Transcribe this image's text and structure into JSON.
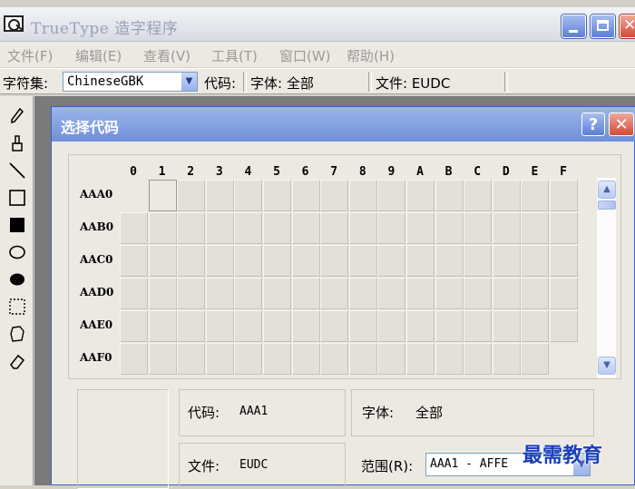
{
  "window": {
    "title": "TrueType 造字程序",
    "icon": "magnifier-icon"
  },
  "menu": [
    {
      "label": "文件(F)"
    },
    {
      "label": "编辑(E)"
    },
    {
      "label": "查看(V)"
    },
    {
      "label": "工具(T)"
    },
    {
      "label": "窗口(W)"
    },
    {
      "label": "帮助(H)"
    }
  ],
  "toolbar": {
    "charset_label": "字符集:",
    "charset_value": "ChineseGBK",
    "code_label": "代码:",
    "font_text": "字体: 全部",
    "file_text": "文件: EUDC"
  },
  "tools": [
    "pencil-icon",
    "brush-icon",
    "line-icon",
    "hollow-rectangle-icon",
    "filled-rectangle-icon",
    "hollow-ellipse-icon",
    "filled-ellipse-icon",
    "rectangle-select-icon",
    "freeform-select-icon",
    "eraser-icon"
  ],
  "dialog": {
    "title": "选择代码",
    "help_label": "?",
    "close_label": "✕",
    "column_headers": [
      "0",
      "1",
      "2",
      "3",
      "4",
      "5",
      "6",
      "7",
      "8",
      "9",
      "A",
      "B",
      "C",
      "D",
      "E",
      "F"
    ],
    "row_headers": [
      "AAA0",
      "AAB0",
      "AAC0",
      "AAD0",
      "AAE0",
      "AAF0"
    ],
    "code_label": "代码:",
    "code_value": "AAA1",
    "font_label": "字体:",
    "font_value": "全部",
    "file_label": "文件:",
    "file_value": "EUDC",
    "range_label": "范围(R):",
    "range_value": "AAA1 - AFFE"
  },
  "watermark": "最需教育",
  "colors": {
    "dialog_title": "#6f90d8",
    "window_chrome": "#ece9e2",
    "close_button": "#d34a35",
    "watermark": "#1a3fbb"
  }
}
